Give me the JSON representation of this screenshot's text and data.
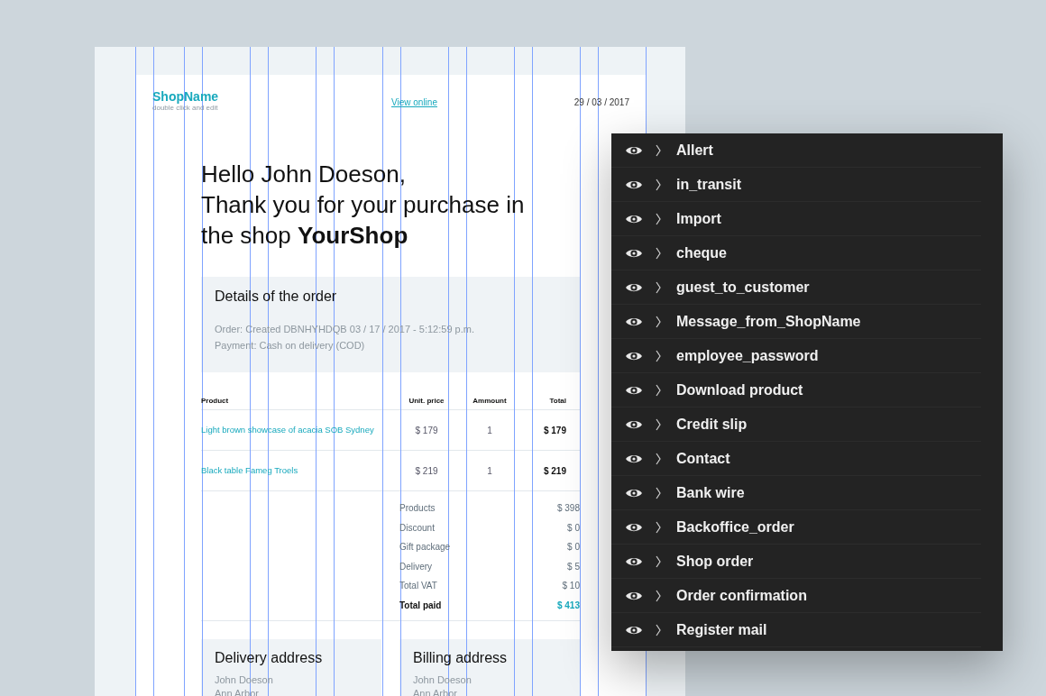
{
  "email": {
    "header": {
      "shop_name": "ShopName",
      "shop_hint": "double click and edit",
      "view_online": "View online",
      "date": "29 / 03 / 2017"
    },
    "greeting": [
      "Hello John Doeson,",
      "Thank you for your purchase in the shop **YourShop**"
    ],
    "order_details": {
      "title": "Details of the order",
      "lines": [
        "Order: Created DBNHYHDQB 03 / 17 / 2017 - 5:12:59 p.m.",
        "Payment: Cash on delivery (COD)"
      ]
    },
    "table": {
      "columns": [
        "Product",
        "Unit. price",
        "Ammount",
        "Total"
      ],
      "rows": [
        {
          "product": "Light brown showcase of acacia SOB Sydney",
          "unit_price": "$ 179",
          "amount": "1",
          "total": "$ 179"
        },
        {
          "product": "Black table Fameg Troels",
          "unit_price": "$ 219",
          "amount": "1",
          "total": "$ 219"
        }
      ]
    },
    "totals": [
      {
        "kind": "line",
        "label": "Products",
        "value": "$ 398"
      },
      {
        "kind": "line",
        "label": "Discount",
        "value": "$ 0"
      },
      {
        "kind": "line",
        "label": "Gift package",
        "value": "$ 0"
      },
      {
        "kind": "line",
        "label": "Delivery",
        "value": "$ 5"
      },
      {
        "kind": "line",
        "label": "Total VAT",
        "value": "$ 10"
      },
      {
        "kind": "total",
        "label": "Total paid",
        "value": "$ 413"
      }
    ],
    "addresses": [
      {
        "title": "Delivery address",
        "lines": [
          "John Doeson",
          "Ann Arbor"
        ]
      },
      {
        "title": "Billing address",
        "lines": [
          "John Doeson",
          "Ann Arbor"
        ]
      }
    ]
  },
  "layers": [
    {
      "name": "Allert",
      "visible": true,
      "expanded": false
    },
    {
      "name": "in_transit",
      "visible": true,
      "expanded": false
    },
    {
      "name": "Import",
      "visible": true,
      "expanded": false
    },
    {
      "name": "cheque",
      "visible": true,
      "expanded": false
    },
    {
      "name": "guest_to_customer",
      "visible": true,
      "expanded": false
    },
    {
      "name": "Message_from_ShopName",
      "visible": true,
      "expanded": false
    },
    {
      "name": "employee_password",
      "visible": true,
      "expanded": false
    },
    {
      "name": "Download product",
      "visible": true,
      "expanded": false
    },
    {
      "name": "Credit slip",
      "visible": true,
      "expanded": false
    },
    {
      "name": "Contact",
      "visible": true,
      "expanded": false
    },
    {
      "name": "Bank wire",
      "visible": true,
      "expanded": false
    },
    {
      "name": "Backoffice_order",
      "visible": true,
      "expanded": false
    },
    {
      "name": "Shop order",
      "visible": true,
      "expanded": false
    },
    {
      "name": "Order confirmation",
      "visible": true,
      "expanded": false
    },
    {
      "name": "Register mail",
      "visible": true,
      "expanded": false
    }
  ]
}
